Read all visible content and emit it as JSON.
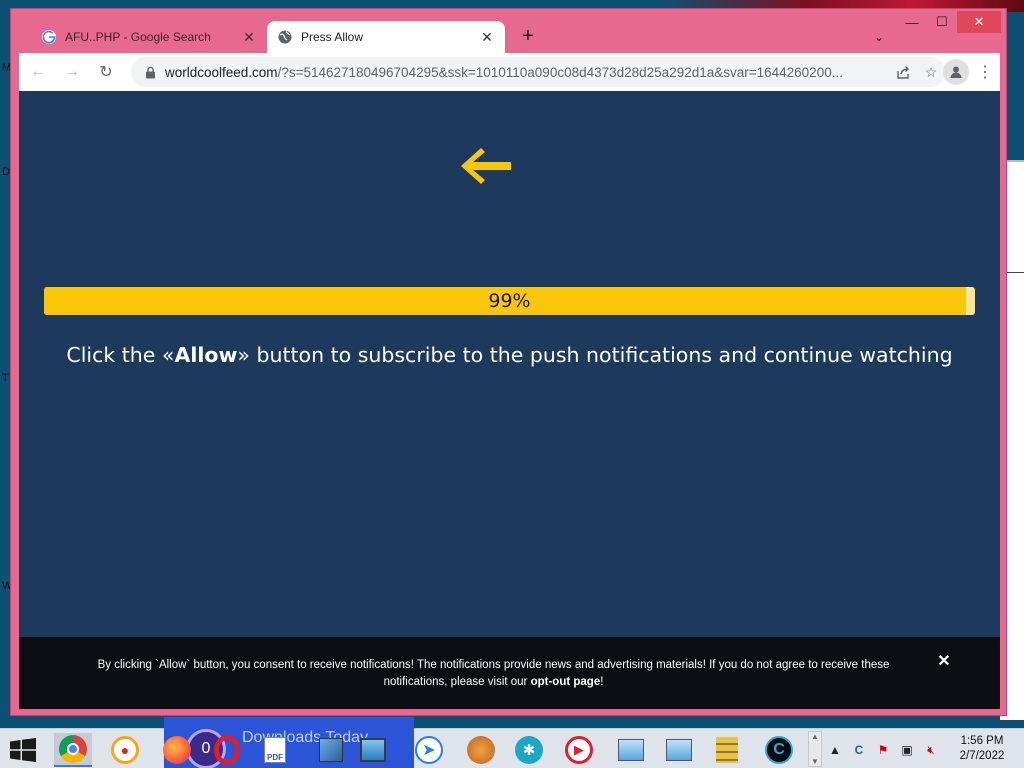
{
  "desktop": {
    "left_letters": [
      "M",
      "D",
      "T",
      "W"
    ]
  },
  "browser": {
    "tabs": [
      {
        "title": "AFU..PHP - Google Search",
        "active": false
      },
      {
        "title": "Press Allow",
        "active": true
      }
    ],
    "new_tab_label": "+",
    "window_controls": {
      "minimize": "—",
      "maximize": "☐",
      "close": "✕"
    },
    "toolbar": {
      "back": "←",
      "forward": "→",
      "reload": "↻",
      "url_host": "worldcoolfeed.com",
      "url_path": "/?s=514627180496704295&ssk=1010110a090c08d4373d28d25a292d1a&svar=1644260200...",
      "share_icon": "share-icon",
      "bookmark_icon": "star-icon",
      "menu": "⋮"
    }
  },
  "page": {
    "progress_percent": 99,
    "progress_label": "99%",
    "headline_pre": "Click the «",
    "headline_bold": "Allow",
    "headline_post": "» button to subscribe to the push notifications and continue watching",
    "accent_color": "#f9c70a",
    "background_color": "#1d3a5c",
    "consent_text": "By clicking `Allow` button, you consent to receive notifications! The notifications provide news and advertising materials! If you do not agree to receive these notifications, please visit our ",
    "consent_link": "opt-out page",
    "consent_end": "!",
    "consent_close": "✕"
  },
  "taskbar": {
    "thumbnail_text": "Downloads Today",
    "thumbnail_badge": "0",
    "clock_time": "1:56 PM",
    "clock_date": "2/7/2022"
  }
}
